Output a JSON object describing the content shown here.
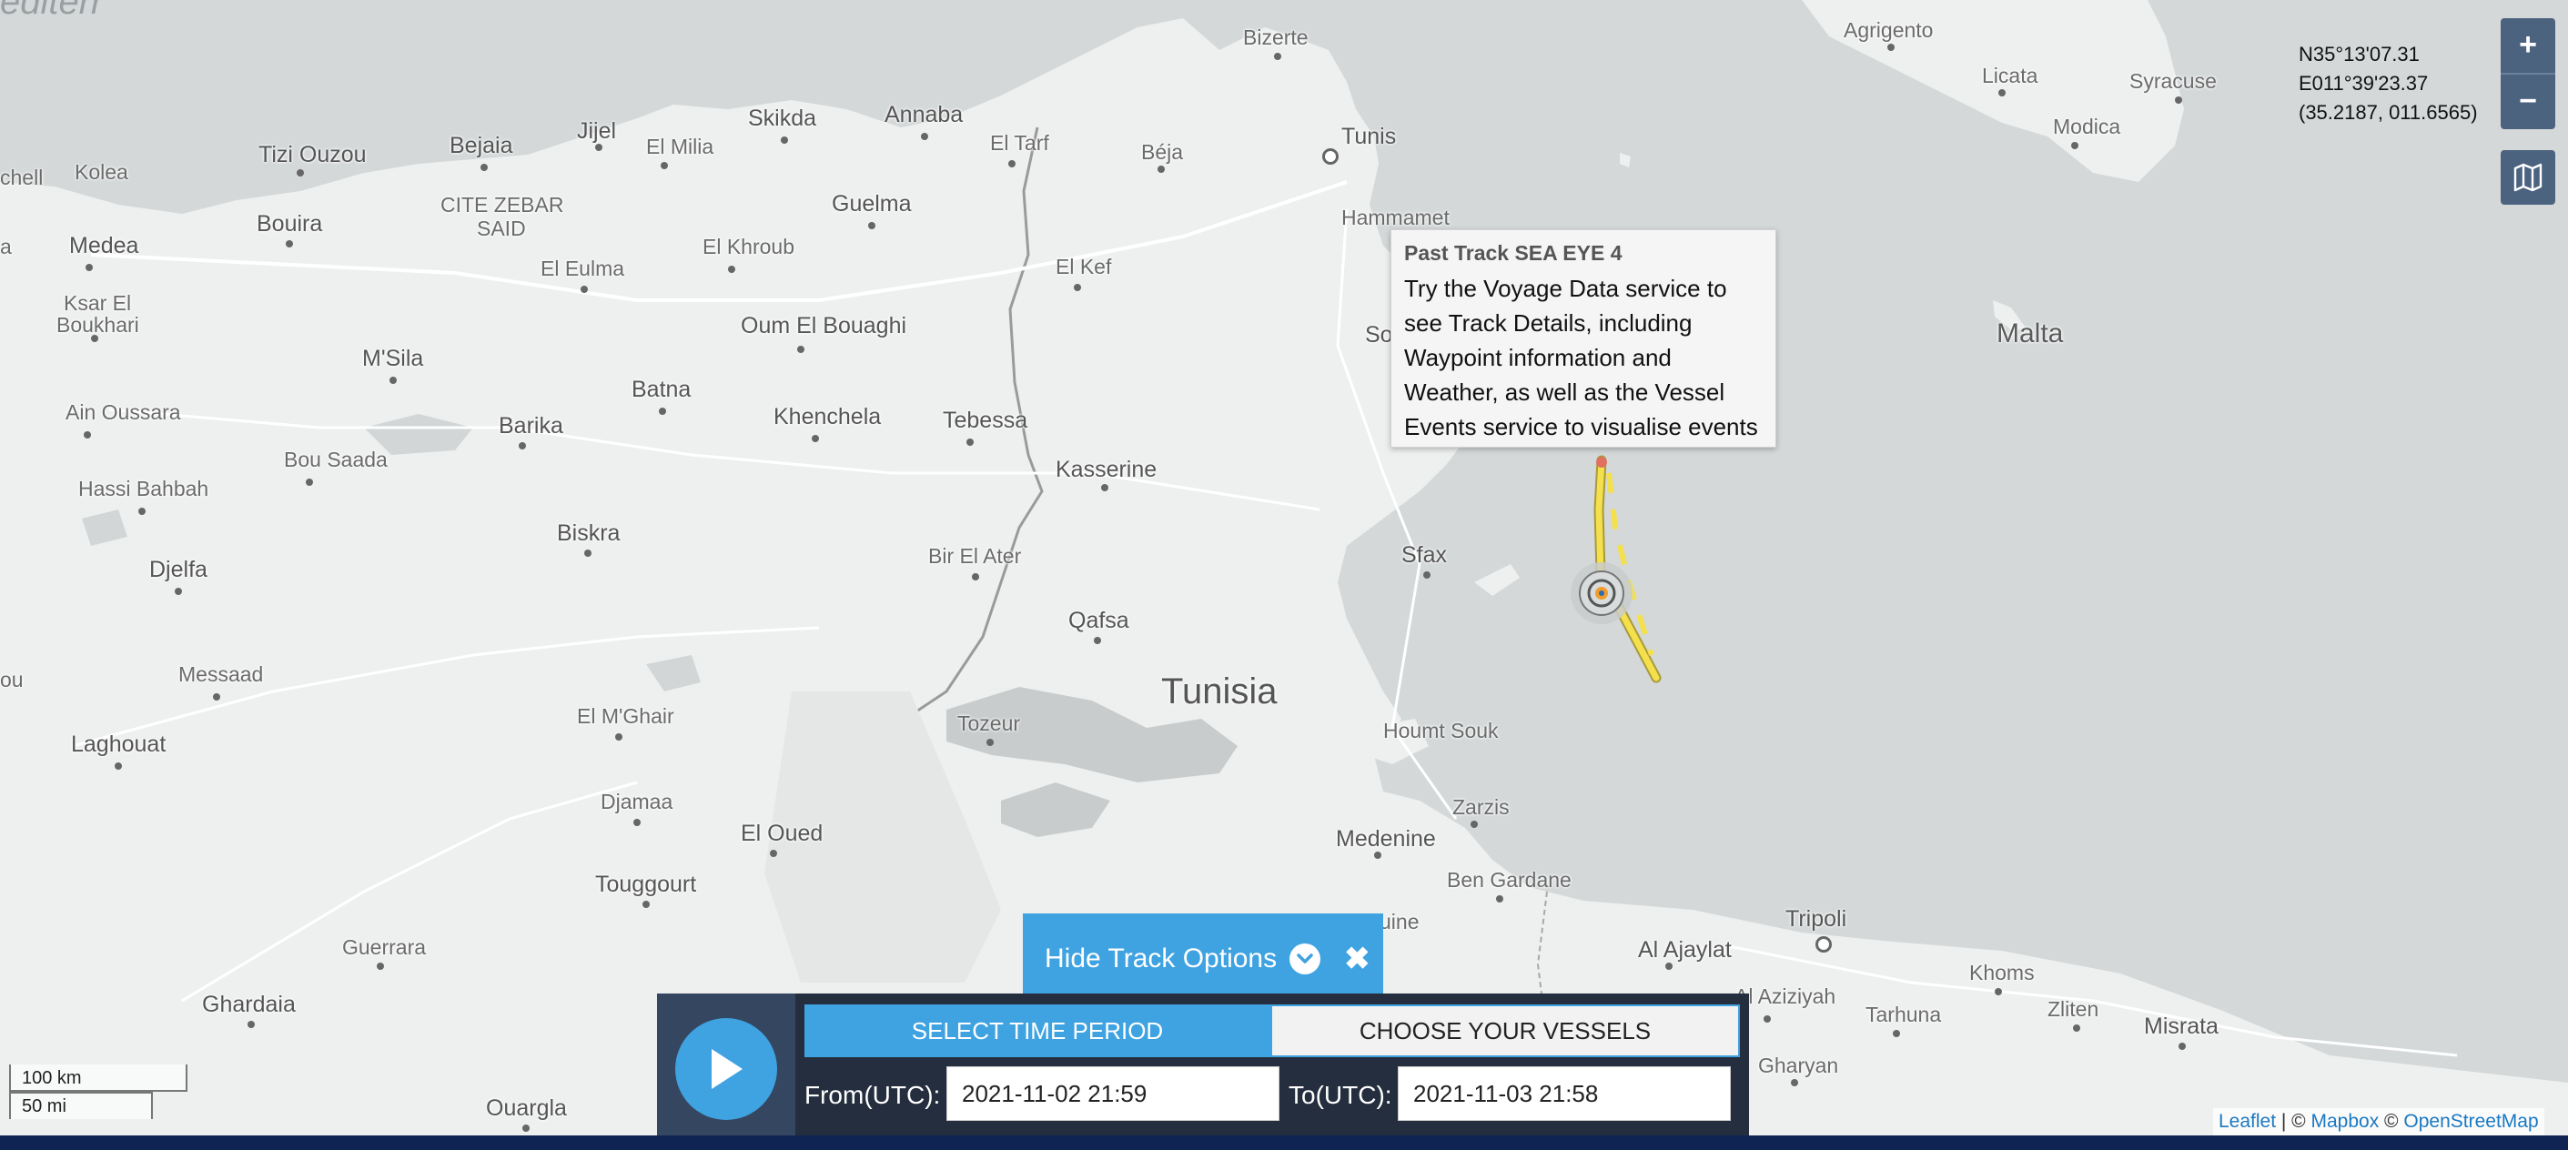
{
  "map": {
    "place_labels": [
      {
        "id": "bizerte",
        "text": "Bizerte"
      },
      {
        "id": "agrigento",
        "text": "Agrigento"
      },
      {
        "id": "licata",
        "text": "Licata"
      },
      {
        "id": "syracuse",
        "text": "Syracuse"
      },
      {
        "id": "modica",
        "text": "Modica"
      },
      {
        "id": "tunis",
        "text": "Tunis"
      },
      {
        "id": "hammamet",
        "text": "Hammamet"
      },
      {
        "id": "jijel",
        "text": "Jijel"
      },
      {
        "id": "skikda",
        "text": "Skikda"
      },
      {
        "id": "annaba",
        "text": "Annaba"
      },
      {
        "id": "el-milia",
        "text": "El Milia"
      },
      {
        "id": "el-tarf",
        "text": "El Tarf"
      },
      {
        "id": "beja",
        "text": "Béja"
      },
      {
        "id": "tizi-ouzou",
        "text": "Tizi Ouzou"
      },
      {
        "id": "bejaia",
        "text": "Bejaia"
      },
      {
        "id": "kolea",
        "text": "Kolea"
      },
      {
        "id": "chell",
        "text": "chell"
      },
      {
        "id": "cite-zebar",
        "text": "CITE ZEBAR"
      },
      {
        "id": "said",
        "text": "SAID"
      },
      {
        "id": "guelma",
        "text": "Guelma"
      },
      {
        "id": "bouira",
        "text": "Bouira"
      },
      {
        "id": "medea",
        "text": "Medea"
      },
      {
        "id": "el-khroub",
        "text": "El Khroub"
      },
      {
        "id": "el-kef",
        "text": "El Kef"
      },
      {
        "id": "el-eulma",
        "text": "El Eulma"
      },
      {
        "id": "ksar-el-boukhari-1",
        "text": "Ksar El"
      },
      {
        "id": "ksar-el-boukhari-2",
        "text": "Boukhari"
      },
      {
        "id": "oum-el-bouaghi",
        "text": "Oum El Bouaghi"
      },
      {
        "id": "so",
        "text": "So"
      },
      {
        "id": "msila",
        "text": "M'Sila"
      },
      {
        "id": "batna",
        "text": "Batna"
      },
      {
        "id": "ain-oussara",
        "text": "Ain Oussara"
      },
      {
        "id": "barika",
        "text": "Barika"
      },
      {
        "id": "khenchela",
        "text": "Khenchela"
      },
      {
        "id": "tebessa",
        "text": "Tebessa"
      },
      {
        "id": "bou-saada",
        "text": "Bou Saada"
      },
      {
        "id": "kasserine",
        "text": "Kasserine"
      },
      {
        "id": "hassi-bahbah",
        "text": "Hassi Bahbah"
      },
      {
        "id": "biskra",
        "text": "Biskra"
      },
      {
        "id": "sfax",
        "text": "Sfax"
      },
      {
        "id": "bir-el-ater",
        "text": "Bir El Ater"
      },
      {
        "id": "djelfa",
        "text": "Djelfa"
      },
      {
        "id": "qafsa",
        "text": "Qafsa"
      },
      {
        "id": "messaad",
        "text": "Messaad"
      },
      {
        "id": "el-mghair",
        "text": "El M'Ghair"
      },
      {
        "id": "tozeur",
        "text": "Tozeur"
      },
      {
        "id": "houmt-souk",
        "text": "Houmt Souk"
      },
      {
        "id": "laghouat",
        "text": "Laghouat"
      },
      {
        "id": "djamaa",
        "text": "Djamaa"
      },
      {
        "id": "zarzis",
        "text": "Zarzis"
      },
      {
        "id": "medenine",
        "text": "Medenine"
      },
      {
        "id": "el-oued",
        "text": "El Oued"
      },
      {
        "id": "touggourt",
        "text": "Touggourt"
      },
      {
        "id": "ben-gardane",
        "text": "Ben Gardane"
      },
      {
        "id": "uine",
        "text": "uine"
      },
      {
        "id": "tripoli",
        "text": "Tripoli"
      },
      {
        "id": "al-ajaylat",
        "text": "Al Ajaylat"
      },
      {
        "id": "guerrara",
        "text": "Guerrara"
      },
      {
        "id": "ghardaia",
        "text": "Ghardaia"
      },
      {
        "id": "al-aziziyah",
        "text": "Al Aziziyah"
      },
      {
        "id": "tarhuna",
        "text": "Tarhuna"
      },
      {
        "id": "khoms",
        "text": "Khoms"
      },
      {
        "id": "zliten",
        "text": "Zliten"
      },
      {
        "id": "misrata",
        "text": "Misrata"
      },
      {
        "id": "gharyan",
        "text": "Gharyan"
      },
      {
        "id": "ouargla",
        "text": "Ouargla"
      },
      {
        "id": "ou",
        "text": "ou"
      },
      {
        "id": "a",
        "text": "a"
      }
    ],
    "country_label": "Tunisia",
    "island_label": "Malta",
    "sea_label": "editerr",
    "vessel_track_color": "#f4e04d"
  },
  "coordinates": {
    "lat": "N35°13'07.31",
    "lon": "E011°39'23.37",
    "decimal": "(35.2187, 011.6565)"
  },
  "controls": {
    "zoom_in": "+",
    "zoom_out": "−",
    "layers_icon": "map-layers-icon"
  },
  "popup": {
    "title": "Past Track SEA EYE 4",
    "body": "Try the Voyage Data service to see Track Details, including Waypoint information and Weather, as well as the Vessel Events service to visualise events"
  },
  "track_options": {
    "toggle_label": "Hide Track Options",
    "close_symbol": "✖",
    "tab_time": "SELECT TIME PERIOD",
    "tab_vessels": "CHOOSE YOUR VESSELS",
    "from_label": "From(UTC):",
    "from_value": "2021-11-02 21:59",
    "to_label": "To(UTC):",
    "to_value": "2021-11-03 21:58",
    "accent_color": "#3fa2e1"
  },
  "scale": {
    "km": "100 km",
    "mi": "50 mi"
  },
  "attribution": {
    "leaflet": "Leaflet",
    "sep1": " | © ",
    "mapbox": "Mapbox",
    "sep2": " © ",
    "osm": "OpenStreetMap"
  }
}
